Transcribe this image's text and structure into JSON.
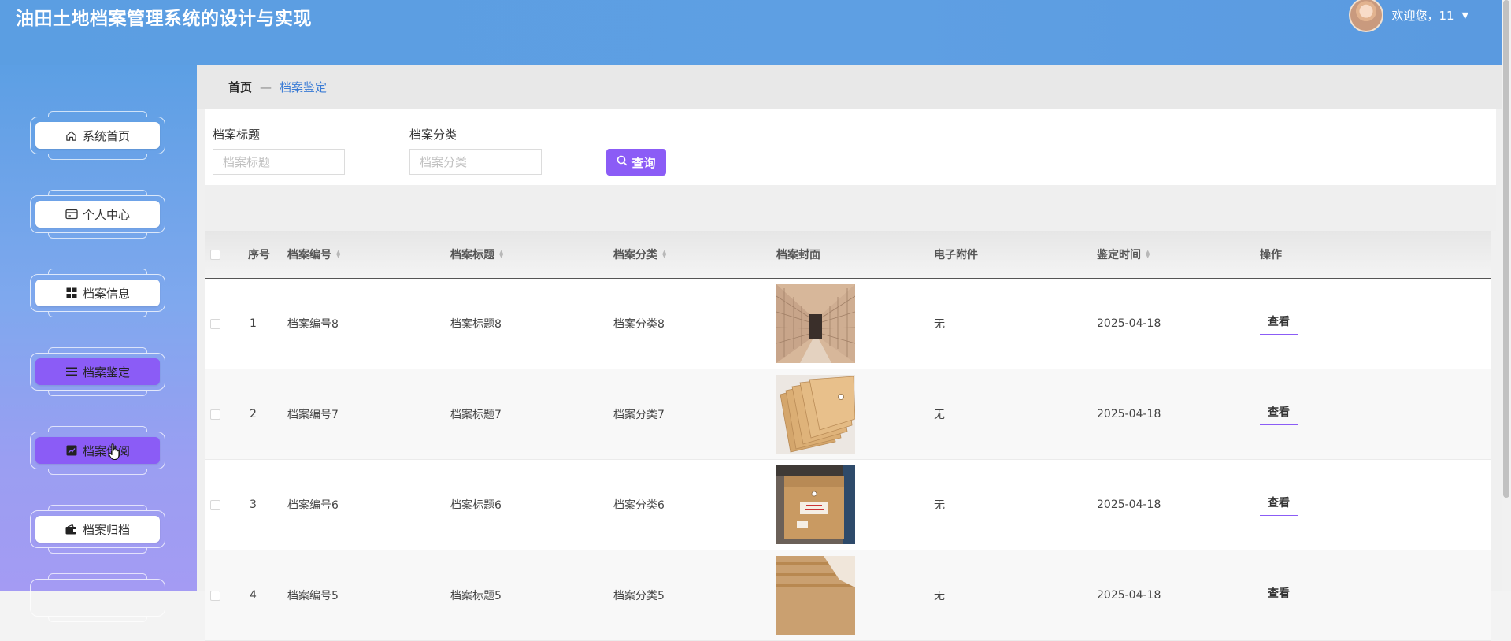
{
  "header": {
    "title": "油田土地档案管理系统的设计与实现",
    "welcome": "欢迎您，11"
  },
  "sidebar": {
    "items": [
      {
        "label": "系统首页",
        "icon": "home-icon",
        "active": false
      },
      {
        "label": "个人中心",
        "icon": "card-icon",
        "active": false
      },
      {
        "label": "档案信息",
        "icon": "grid-icon",
        "active": false
      },
      {
        "label": "档案鉴定",
        "icon": "list-icon",
        "active": true
      },
      {
        "label": "档案借阅",
        "icon": "chart-icon",
        "active": true
      },
      {
        "label": "档案归档",
        "icon": "wallet-icon",
        "active": false
      }
    ]
  },
  "breadcrumb": {
    "home": "首页",
    "separator": "—",
    "current": "档案鉴定"
  },
  "search": {
    "title_label": "档案标题",
    "title_placeholder": "档案标题",
    "category_label": "档案分类",
    "category_placeholder": "档案分类",
    "query_label": "查询"
  },
  "table": {
    "columns": [
      "序号",
      "档案编号",
      "档案标题",
      "档案分类",
      "档案封面",
      "电子附件",
      "鉴定时间",
      "操作"
    ],
    "rows": [
      {
        "index": "1",
        "code": "档案编号8",
        "title": "档案标题8",
        "category": "档案分类8",
        "attachment": "无",
        "date": "2025-04-18",
        "action": "查看"
      },
      {
        "index": "2",
        "code": "档案编号7",
        "title": "档案标题7",
        "category": "档案分类7",
        "attachment": "无",
        "date": "2025-04-18",
        "action": "查看"
      },
      {
        "index": "3",
        "code": "档案编号6",
        "title": "档案标题6",
        "category": "档案分类6",
        "attachment": "无",
        "date": "2025-04-18",
        "action": "查看"
      },
      {
        "index": "4",
        "code": "档案编号5",
        "title": "档案标题5",
        "category": "档案分类5",
        "attachment": "无",
        "date": "2025-04-18",
        "action": "查看"
      }
    ]
  },
  "colors": {
    "header_bg": "#5b9ee2",
    "accent": "#8b5cf6",
    "breadcrumb_link": "#3a7bd5"
  }
}
